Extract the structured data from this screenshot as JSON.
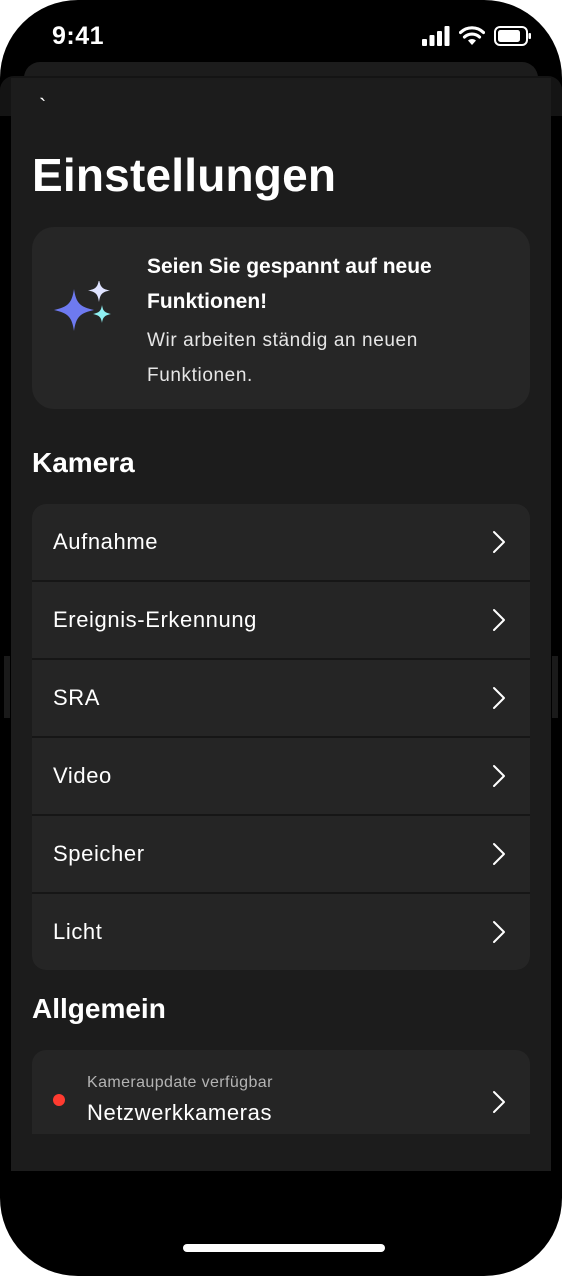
{
  "status_bar": {
    "time": "9:41",
    "icons": [
      "signal-icon",
      "wifi-icon",
      "battery-icon"
    ]
  },
  "nav": {
    "back_glyph": "`"
  },
  "page": {
    "title": "Einstellungen"
  },
  "promo": {
    "title": "Seien Sie gespannt auf neue Funktionen!",
    "text": "Wir arbeiten ständig an neuen Funktionen.",
    "icon": "sparkles-icon",
    "colors": {
      "sparkle_large": "#6e7af0",
      "sparkle_top": "#dfe3ff",
      "sparkle_small": "#8ff0f3"
    }
  },
  "sections": {
    "kamera": {
      "title": "Kamera",
      "items": [
        {
          "label": "Aufnahme"
        },
        {
          "label": "Ereignis-Erkennung"
        },
        {
          "label": "SRA"
        },
        {
          "label": "Video"
        },
        {
          "label": "Speicher"
        },
        {
          "label": "Licht"
        }
      ]
    },
    "allgemein": {
      "title": "Allgemein",
      "items": [
        {
          "sublabel": "Kameraupdate verfügbar",
          "label": "Netzwerkkameras",
          "status_color": "#ff3b30"
        }
      ]
    }
  },
  "theme": {
    "background": "#000000",
    "surface": "#1c1c1c",
    "card": "#252525",
    "text": "#ffffff"
  }
}
